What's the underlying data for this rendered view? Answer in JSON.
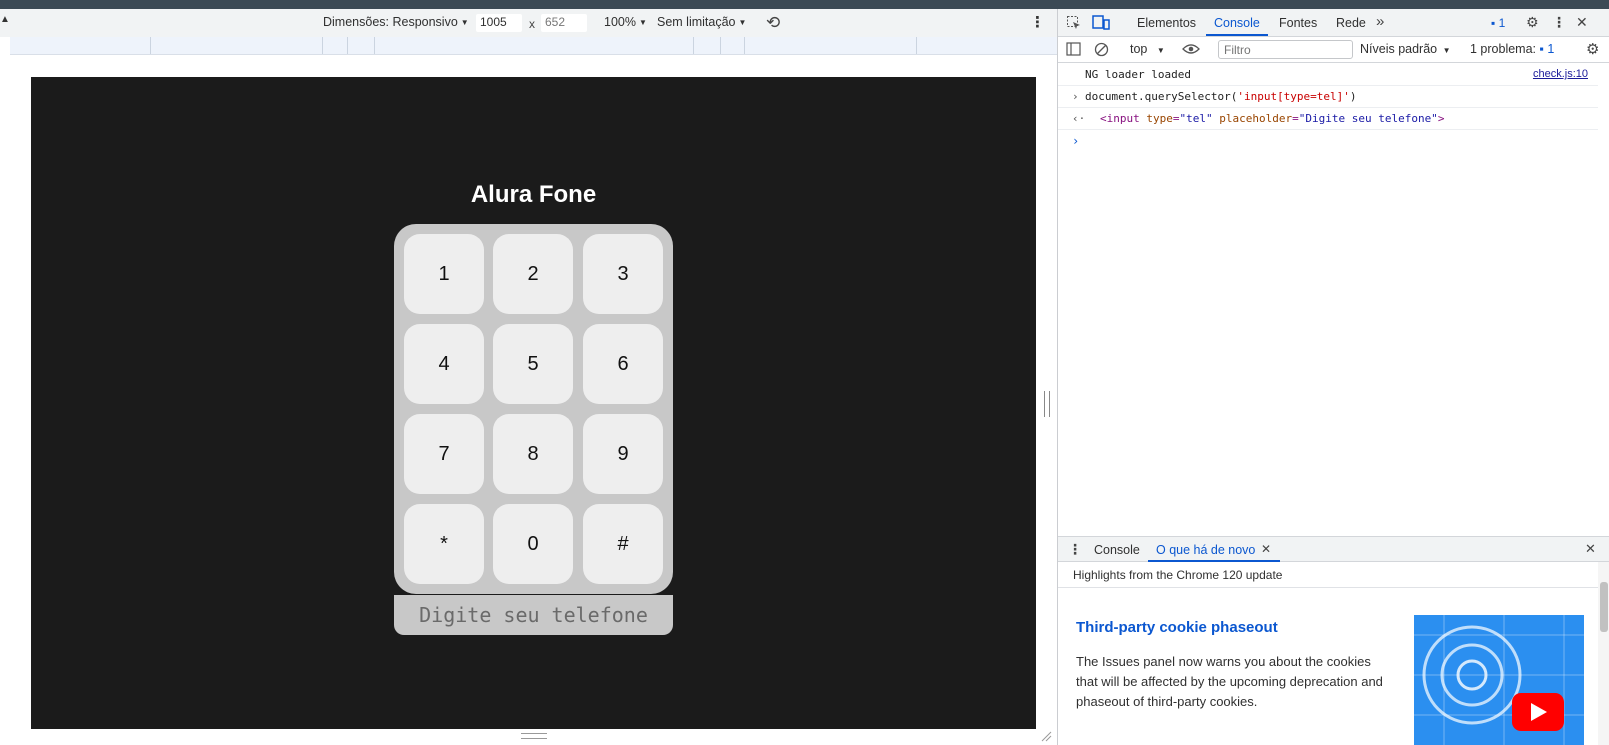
{
  "device_toolbar": {
    "dimensions_label": "Dimensões: Responsivo",
    "width_value": "1005",
    "height_value": "652",
    "times": "x",
    "zoom": "100%",
    "throttling": "Sem limitação"
  },
  "app": {
    "title": "Alura Fone",
    "keys": [
      "1",
      "2",
      "3",
      "4",
      "5",
      "6",
      "7",
      "8",
      "9",
      "*",
      "0",
      "#"
    ],
    "input_placeholder": "Digite seu telefone"
  },
  "devtools": {
    "tabs": [
      "Elementos",
      "Console",
      "Fontes",
      "Rede"
    ],
    "active_tab": "Console",
    "issues_count": "1",
    "toolbar": {
      "context": "top",
      "filter_placeholder": "Filtro",
      "levels": "Níveis padrão",
      "problems_label": "1 problema:",
      "problems_count": "1"
    },
    "console": {
      "log_text": "NG loader loaded",
      "log_source": "check.js:10",
      "command_prefix": "document.querySelector(",
      "command_arg": "'input[type=tel]'",
      "command_suffix": ")",
      "result_tag_open": "<input",
      "result_attr1": "type",
      "result_val1": "\"tel\"",
      "result_attr2": "placeholder",
      "result_val2": "\"Digite seu telefone\"",
      "result_tag_close": ">"
    },
    "drawer": {
      "tabs": [
        "Console",
        "O que há de novo"
      ],
      "active_tab": "O que há de novo",
      "highlights": "Highlights from the Chrome 120 update",
      "news_title": "Third-party cookie phaseout",
      "news_body": "The Issues panel now warns you about the cookies that will be affected by the upcoming deprecation and phaseout of third-party cookies."
    }
  },
  "colors": {
    "viewport_bg": "#1b1b1b",
    "keypad_bg": "#c8c8c8",
    "key_bg": "#eeeeee",
    "accent": "#0b57d0"
  }
}
